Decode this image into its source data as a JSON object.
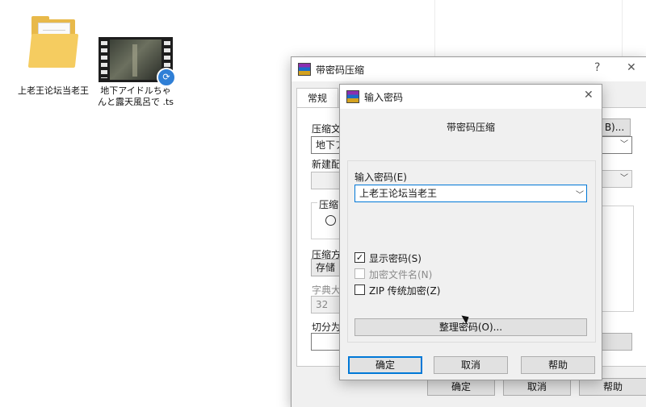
{
  "desktop": {
    "icons": [
      {
        "name": "上老王论坛当老王",
        "type": "folder-icon"
      },
      {
        "name": "地下アイドルちゃんと露天風呂で .ts",
        "type": "video-file-icon"
      }
    ]
  },
  "bg_window": {
    "title": "带密码压缩",
    "help_btn": "?",
    "close_btn": "✕",
    "tab_general": "常规",
    "label_archive_name": "压缩文",
    "archive_name_value": "地下ア",
    "browse_btn": "B)...",
    "label_update_mode": "新建配",
    "label_format": "压缩",
    "label_method": "压缩方",
    "method_value": "存储",
    "label_dict": "字典大",
    "dict_value": "32",
    "label_split": "切分为",
    "ok_btn": "确定",
    "cancel_btn": "取消",
    "help_btn2": "帮助"
  },
  "dialog": {
    "title": "输入密码",
    "close_btn": "✕",
    "heading": "带密码压缩",
    "password_label": "输入密码(E)",
    "password_value": "上老王论坛当老王",
    "show_password": "显示密码(S)",
    "encrypt_names": "加密文件名(N)",
    "zip_legacy": "ZIP 传统加密(Z)",
    "organize_btn": "整理密码(O)...",
    "ok_btn": "确定",
    "cancel_btn": "取消",
    "help_btn": "帮助",
    "checked_mark": "✓"
  }
}
